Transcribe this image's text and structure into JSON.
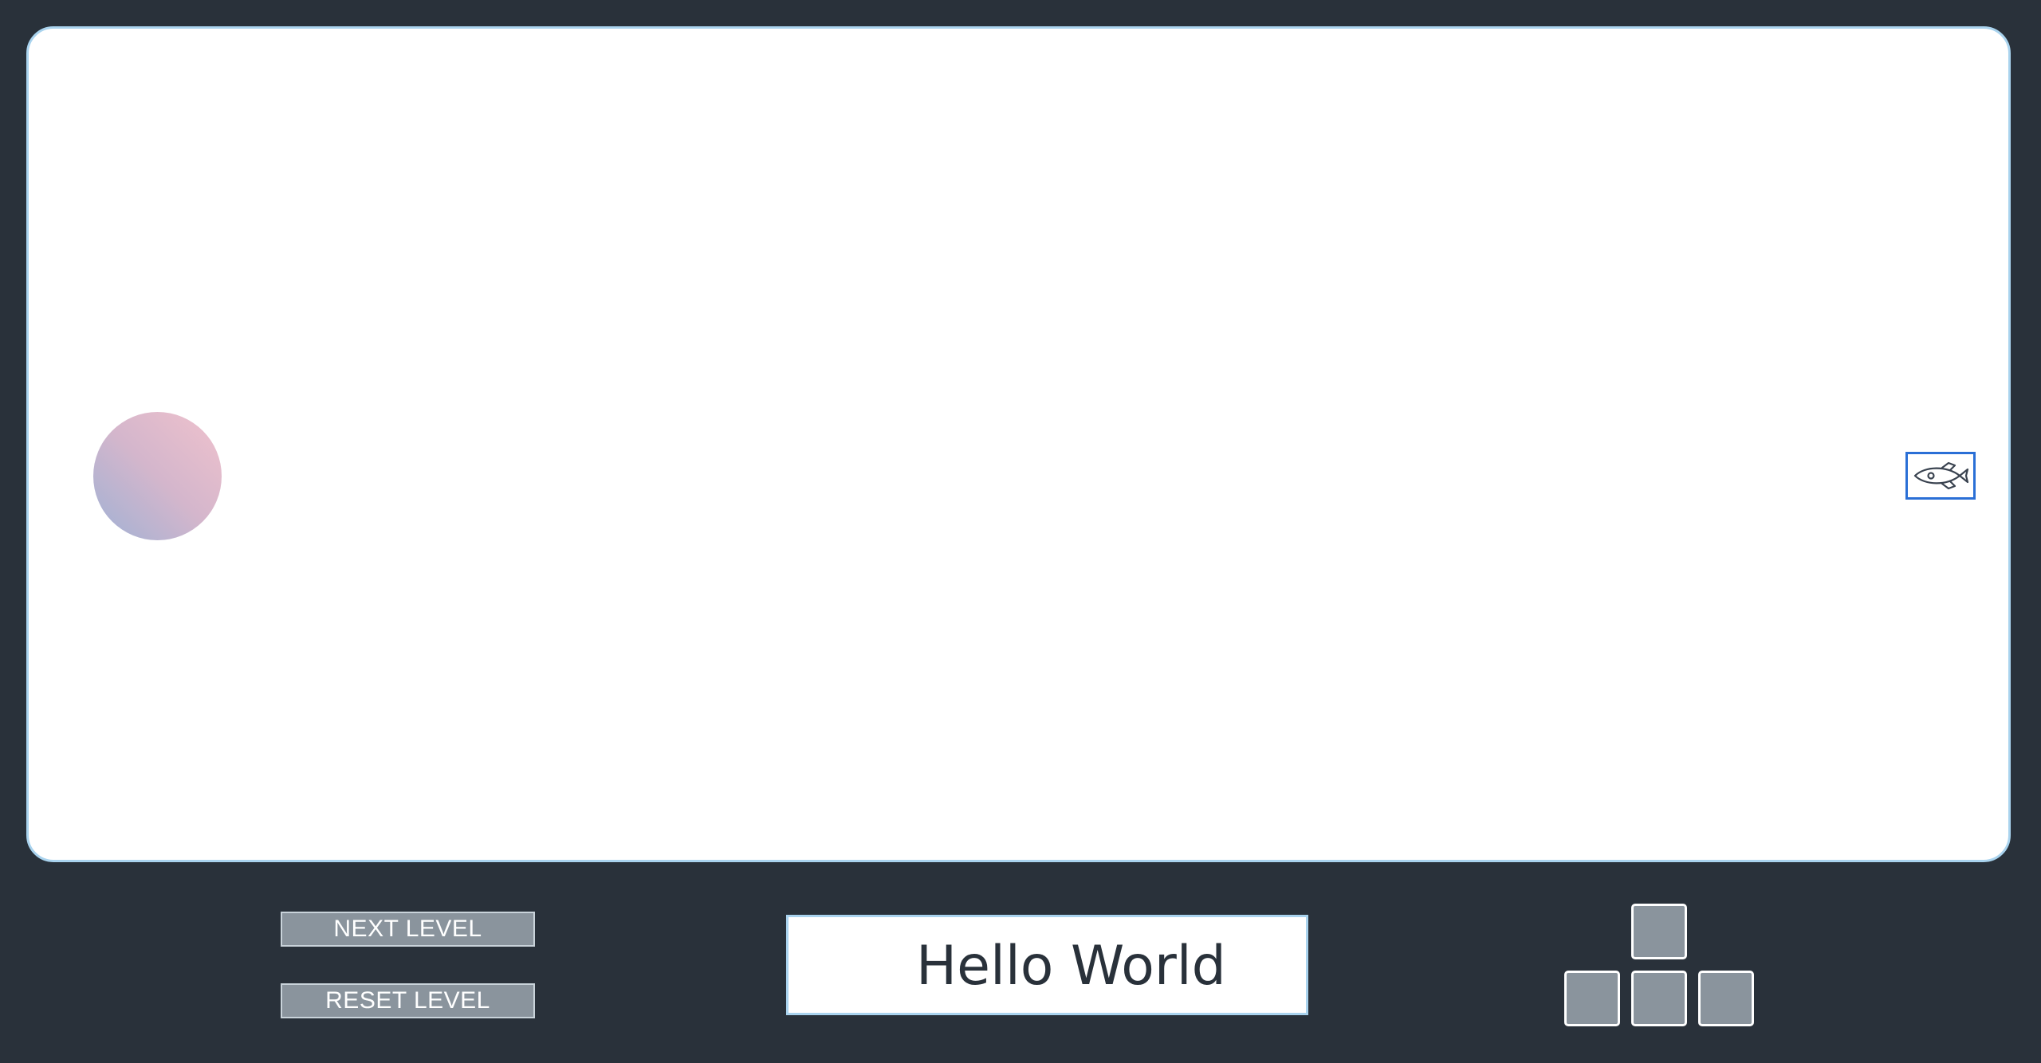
{
  "game": {
    "player": {
      "icon": "rocket-icon",
      "color": "#2a6fd6"
    },
    "target": {
      "icon": "gradient-orb",
      "colors": [
        "#9fb1d4",
        "#f0c2cd"
      ]
    }
  },
  "controls": {
    "next_level_label": "NEXT LEVEL",
    "reset_level_label": "RESET LEVEL"
  },
  "message": {
    "text": "Hello World"
  },
  "arrow_keys": [
    {
      "name": "up"
    },
    {
      "name": "left"
    },
    {
      "name": "down"
    },
    {
      "name": "right"
    }
  ],
  "colors": {
    "background": "#29313a",
    "playfield": "#ffffff",
    "border": "#a9d3ee",
    "button": "#8a949d"
  }
}
